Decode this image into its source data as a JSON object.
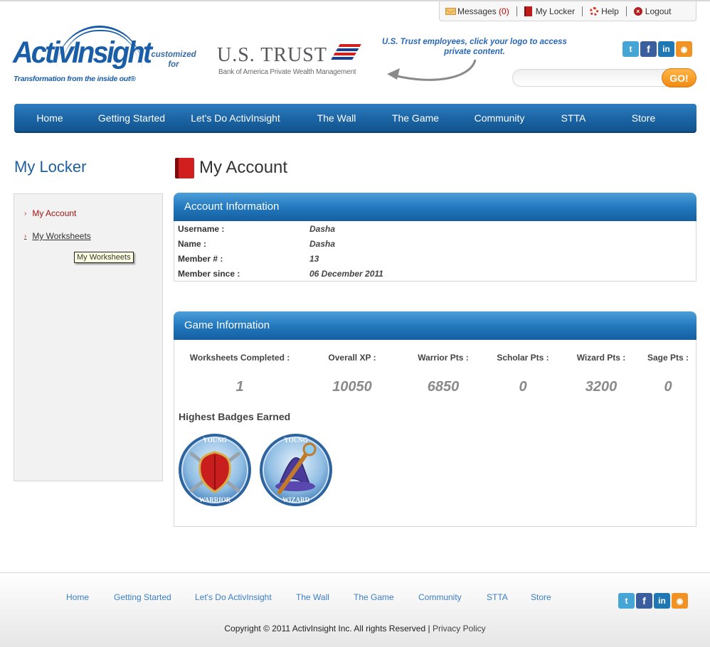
{
  "util_bar": {
    "messages_label": "Messages",
    "messages_count": "(0)",
    "locker_label": "My Locker",
    "help_label": "Help",
    "logout_label": "Logout"
  },
  "brand": {
    "logo_text": "ActivInsight",
    "tagline": "Transformation from the inside out®",
    "customized_for": "customized for",
    "partner_name": "U.S. TRUST",
    "partner_sub": "Bank of America Private Wealth Management",
    "partner_note": "U.S. Trust employees, click your logo to access private content."
  },
  "social": [
    "twitter-icon",
    "facebook-icon",
    "linkedin-icon",
    "rss-icon"
  ],
  "search": {
    "placeholder": "",
    "button_label": "GO!"
  },
  "nav": [
    "Home",
    "Getting Started",
    "Let's Do ActivInsight",
    "The Wall",
    "The Game",
    "Community",
    "STTA",
    "Store"
  ],
  "sidebar": {
    "title": "My Locker",
    "items": [
      {
        "label": "My Account",
        "active": true
      },
      {
        "label": "My Worksheets",
        "active": false
      }
    ],
    "tooltip": "My Worksheets"
  },
  "main": {
    "title": "My Account",
    "account_panel": {
      "heading": "Account Information",
      "rows": [
        {
          "label": "Username :",
          "value": "Dasha"
        },
        {
          "label": "Name :",
          "value": "Dasha"
        },
        {
          "label": "Member # :",
          "value": "13"
        },
        {
          "label": "Member since :",
          "value": "06 December 2011"
        }
      ]
    },
    "game_panel": {
      "heading": "Game Information",
      "stats": [
        {
          "label": "Worksheets Completed :",
          "value": "1"
        },
        {
          "label": "Overall XP :",
          "value": "10050"
        },
        {
          "label": "Warrior Pts :",
          "value": "6850"
        },
        {
          "label": "Scholar Pts :",
          "value": "0"
        },
        {
          "label": "Wizard Pts :",
          "value": "3200"
        },
        {
          "label": "Sage Pts :",
          "value": "0"
        }
      ],
      "badges_title": "Highest Badges Earned",
      "badges": [
        {
          "top": "YOUNG",
          "bottom": "WARRIOR"
        },
        {
          "top": "YOUNG",
          "bottom": "WIZARD"
        }
      ]
    }
  },
  "footer": {
    "links": [
      "Home",
      "Getting Started",
      "Let's Do ActivInsight",
      "The Wall",
      "The Game",
      "Community",
      "STTA",
      "Store"
    ],
    "copyright": "Copyright © 2011 ActivInsight Inc. All rights Reserved |",
    "privacy": "Privacy Policy"
  },
  "colors": {
    "nav_blue": "#1c66a6",
    "brand_blue": "#1b5ea8",
    "accent_orange": "#f18a10",
    "active_red": "#a01414"
  }
}
